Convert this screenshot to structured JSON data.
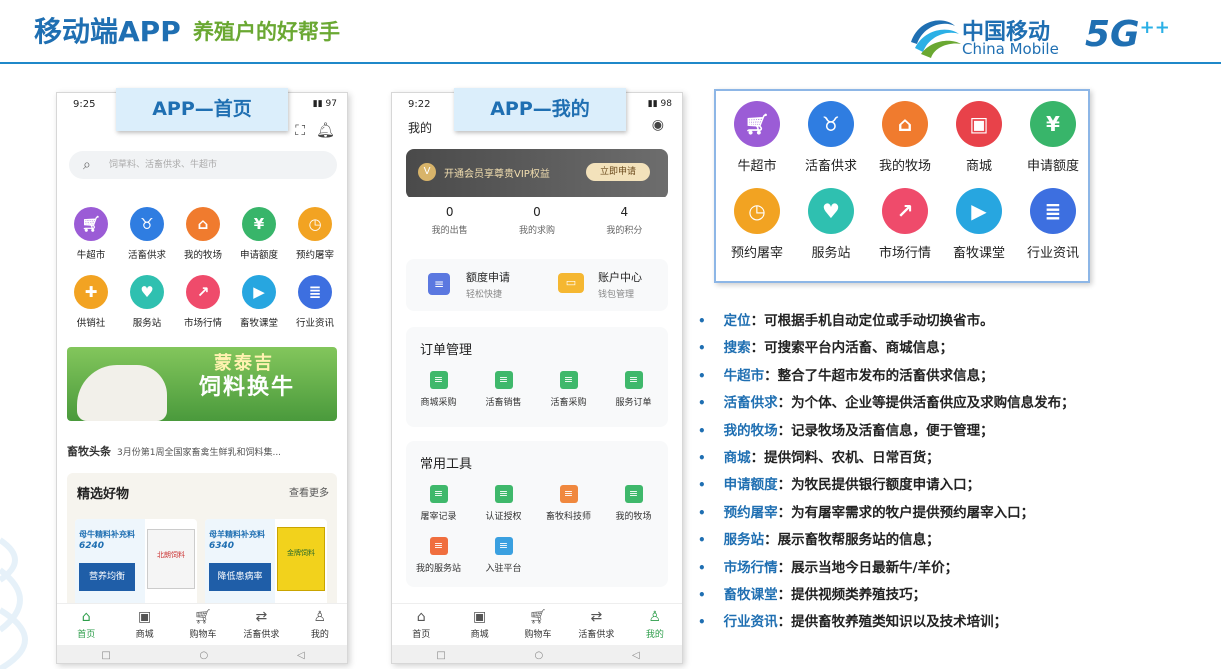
{
  "header": {
    "title": "移动端APP",
    "subtitle": "养殖户的好帮手",
    "brand_cn": "中国移动",
    "brand_en": "China Mobile",
    "brand_5g": "5G"
  },
  "colors": {
    "accent": "#1f6fb2",
    "green": "#6aa832",
    "app_green": "#2e9e4b"
  },
  "phone1": {
    "caption": "APP—首页",
    "time": "9:25",
    "battery": "97",
    "search_placeholder": "饲草料、活畜供求、牛超市",
    "icons": [
      {
        "label": "牛超市",
        "color": "#9b5cd6",
        "glyph": "cart-icon"
      },
      {
        "label": "活畜供求",
        "color": "#2f7de1",
        "glyph": "cattle-icon"
      },
      {
        "label": "我的牧场",
        "color": "#f07b2e",
        "glyph": "farm-icon"
      },
      {
        "label": "申请额度",
        "color": "#38b56a",
        "glyph": "yuan-icon"
      },
      {
        "label": "预约屠宰",
        "color": "#f2a322",
        "glyph": "clock-icon"
      },
      {
        "label": "供销社",
        "color": "#f2a322",
        "glyph": "coop-icon"
      },
      {
        "label": "服务站",
        "color": "#2fc0b0",
        "glyph": "heart-icon"
      },
      {
        "label": "市场行情",
        "color": "#ef4b6b",
        "glyph": "chart-icon"
      },
      {
        "label": "畜牧课堂",
        "color": "#27a6e0",
        "glyph": "play-icon"
      },
      {
        "label": "行业资讯",
        "color": "#3d6fe0",
        "glyph": "news-icon"
      }
    ],
    "banner_line1": "蒙泰吉",
    "banner_line2": "饲料换牛",
    "news_tag": "畜牧头条",
    "news_text": "3月份第1周全国家畜禽生鲜乳和饲料集...",
    "goods_title": "精选好物",
    "goods_more": "查看更多",
    "prod1": {
      "name": "母牛精料补充料",
      "code": "6240",
      "tag": "营养均衡",
      "brand": "北朗饲料"
    },
    "prod2": {
      "name": "母羊精料补充料",
      "code": "6340",
      "tag": "降低患病率",
      "brand": "金牌饲料"
    },
    "tabs": [
      {
        "label": "首页",
        "icon": "home-icon"
      },
      {
        "label": "商城",
        "icon": "shop-icon"
      },
      {
        "label": "购物车",
        "icon": "cart-icon"
      },
      {
        "label": "活畜供求",
        "icon": "exchange-icon"
      },
      {
        "label": "我的",
        "icon": "user-icon"
      }
    ]
  },
  "phone2": {
    "caption": "APP—我的",
    "time": "9:22",
    "battery": "98",
    "page_title": "我的",
    "vip_text": "开通会员享尊贵VIP权益",
    "vip_button": "立即申请",
    "stats": [
      {
        "n": "0",
        "l": "我的出售"
      },
      {
        "n": "0",
        "l": "我的求购"
      },
      {
        "n": "4",
        "l": "我的积分"
      }
    ],
    "quick": [
      {
        "t": "额度申请",
        "s": "轻松快捷"
      },
      {
        "t": "账户中心",
        "s": "钱包管理"
      }
    ],
    "orders_title": "订单管理",
    "orders": [
      "商城采购",
      "活畜销售",
      "活畜采购",
      "服务订单"
    ],
    "tools_title": "常用工具",
    "tools_row1": [
      "屠宰记录",
      "认证授权",
      "畜牧科技师",
      "我的牧场"
    ],
    "tools_row2": [
      "我的服务站",
      "入驻平台"
    ],
    "tabs": [
      {
        "label": "首页",
        "icon": "home-icon"
      },
      {
        "label": "商城",
        "icon": "shop-icon"
      },
      {
        "label": "购物车",
        "icon": "cart-icon"
      },
      {
        "label": "活畜供求",
        "icon": "exchange-icon"
      },
      {
        "label": "我的",
        "icon": "user-icon"
      }
    ]
  },
  "panel": {
    "icons": [
      {
        "label": "牛超市",
        "color": "#9b5cd6"
      },
      {
        "label": "活畜供求",
        "color": "#2f7de1"
      },
      {
        "label": "我的牧场",
        "color": "#f07b2e"
      },
      {
        "label": "商城",
        "color": "#e8424a"
      },
      {
        "label": "申请额度",
        "color": "#38b56a"
      },
      {
        "label": "预约屠宰",
        "color": "#f2a322"
      },
      {
        "label": "服务站",
        "color": "#2fc0b0"
      },
      {
        "label": "市场行情",
        "color": "#ef4b6b"
      },
      {
        "label": "畜牧课堂",
        "color": "#27a6e0"
      },
      {
        "label": "行业资讯",
        "color": "#3d6fe0"
      }
    ]
  },
  "descriptions": [
    {
      "k": "定位",
      "v": "：可根据手机自动定位或手动切换省市。"
    },
    {
      "k": "搜索",
      "v": "：可搜索平台内活畜、商城信息；"
    },
    {
      "k": "牛超市",
      "v": "：整合了牛超市发布的活畜供求信息；"
    },
    {
      "k": "活畜供求",
      "v": "：为个体、企业等提供活畜供应及求购信息发布；"
    },
    {
      "k": "我的牧场",
      "v": "：记录牧场及活畜信息，便于管理；"
    },
    {
      "k": "商城",
      "v": "：提供饲料、农机、日常百货；"
    },
    {
      "k": "申请额度",
      "v": "：为牧民提供银行额度申请入口；"
    },
    {
      "k": "预约屠宰",
      "v": "：为有屠宰需求的牧户提供预约屠宰入口；"
    },
    {
      "k": "服务站",
      "v": "：展示畜牧帮服务站的信息；"
    },
    {
      "k": "市场行情",
      "v": "：展示当地今日最新牛/羊价；"
    },
    {
      "k": "畜牧课堂",
      "v": "：提供视频类养殖技巧；"
    },
    {
      "k": "行业资讯",
      "v": "：提供畜牧养殖类知识以及技术培训；"
    }
  ]
}
